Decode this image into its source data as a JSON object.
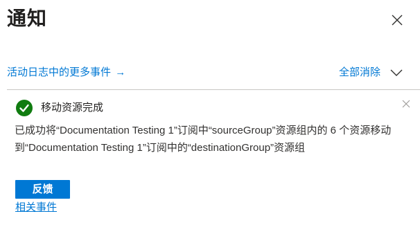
{
  "header": {
    "title": "通知"
  },
  "toolbar": {
    "activity_log_link": "活动日志中的更多事件",
    "activity_log_arrow": "→",
    "dismiss_all": "全部消除"
  },
  "notification": {
    "status": "success",
    "title": "移动资源完成",
    "message": "已成功将“Documentation Testing 1”订阅中“sourceGroup”资源组内的 6 个资源移动到“Documentation Testing 1”订阅中的“destinationGroup”资源组",
    "feedback_button": "反馈",
    "related_events_link": "相关事件"
  },
  "colors": {
    "accent": "#0078d4",
    "success": "#107c10"
  },
  "icons": {
    "close": "close-icon",
    "expand": "chevron-down-icon",
    "success": "checkmark-circle-icon",
    "dismiss": "dismiss-icon"
  }
}
